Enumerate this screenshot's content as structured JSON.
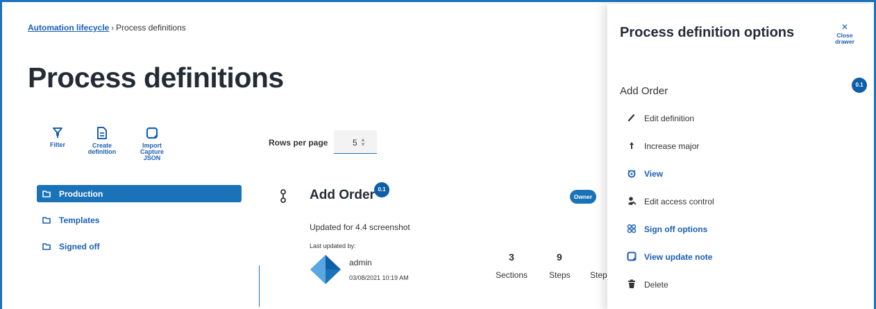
{
  "breadcrumb": {
    "root": "Automation lifecycle",
    "separator": "›",
    "current": "Process definitions"
  },
  "page": {
    "title": "Process definitions"
  },
  "toolbar": {
    "filter": "Filter",
    "create": "Create definition",
    "import": "Import Capture JSON"
  },
  "pagination": {
    "label": "Rows per page",
    "value": "5"
  },
  "folders": [
    {
      "label": "Production",
      "active": true
    },
    {
      "label": "Templates",
      "active": false
    },
    {
      "label": "Signed off",
      "active": false
    }
  ],
  "card": {
    "title": "Add Order",
    "version": "0.1",
    "role": "Owner",
    "description": "Updated for 4.4 screenshot",
    "last_updated_label": "Last updated by:",
    "user": "admin",
    "date": "03/08/2021 10:19 AM",
    "stats": [
      {
        "value": "3",
        "label": "Sections"
      },
      {
        "value": "9",
        "label": "Steps"
      },
      {
        "value": "",
        "label": "Step"
      }
    ]
  },
  "drawer": {
    "title": "Process definition options",
    "close": "Close drawer",
    "definition_name": "Add Order",
    "version": "0.1",
    "options": [
      {
        "label": "Edit definition",
        "icon": "pencil-icon",
        "link": false
      },
      {
        "label": "Increase major",
        "icon": "arrow-up-icon",
        "link": false
      },
      {
        "label": "View",
        "icon": "eye-icon",
        "link": true
      },
      {
        "label": "Edit access control",
        "icon": "access-control-icon",
        "link": false
      },
      {
        "label": "Sign off options",
        "icon": "sign-off-icon",
        "link": true
      },
      {
        "label": "View update note",
        "icon": "note-icon",
        "link": true
      },
      {
        "label": "Delete",
        "icon": "trash-icon",
        "link": false
      }
    ]
  },
  "colors": {
    "accent": "#1a73b8",
    "badge": "#0f5fa8",
    "link": "#1a5fb4",
    "title": "#232c36"
  }
}
